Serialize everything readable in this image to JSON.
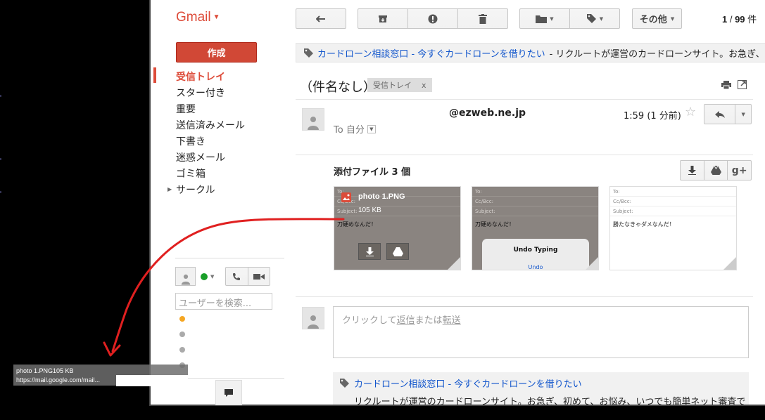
{
  "gmail": {
    "logo": "Gmail",
    "compose": "作成",
    "nav": [
      {
        "label": "受信トレイ",
        "active": true
      },
      {
        "label": "スター付き"
      },
      {
        "label": "重要"
      },
      {
        "label": "送信済みメール"
      },
      {
        "label": "下書き"
      },
      {
        "label": "迷惑メール"
      },
      {
        "label": "ゴミ箱"
      },
      {
        "label": "サークル"
      }
    ],
    "toolbar": {
      "more": "その他",
      "pager_range": "1",
      "pager_sep": " / ",
      "pager_total": "99",
      "pager_unit": " 件"
    }
  },
  "ad_top": {
    "link": "カードローン相談窓口 - 今すぐカードローンを借りたい",
    "text": "- リクルートが運営のカードローンサイト。お急ぎ、初めて"
  },
  "message": {
    "subject": "（件名なし）",
    "label": "受信トレイ",
    "label_close": "x",
    "sender": "@ezweb.ne.jp",
    "to": "To 自分",
    "time": "1:59 (1 分前)"
  },
  "attachments": {
    "title": "添付ファイル 3 個",
    "items": [
      {
        "name": "photo 1.PNG",
        "size": "105 KB",
        "body": "刀硬めなんだ！"
      },
      {
        "name": "",
        "body": "刀硬めなんだ！",
        "popup": "Undo Typing",
        "popup2": "Undo"
      },
      {
        "name": "",
        "body": "勝たなきゃダメなんだ！"
      }
    ],
    "fields": [
      "To:",
      "Cc/Bcc:",
      "Subject:"
    ]
  },
  "reply": {
    "prefix": "クリックして",
    "reply_link": "返信",
    "middle": "または",
    "forward_link": "転送"
  },
  "ad_bottom": {
    "link": "カードローン相談窓口 - 今すぐカードローンを借りたい",
    "text": "リクルートが運営のカードローンサイト。お急ぎ、初めて、お悩み、いつでも簡単ネット審査で大丈夫！"
  },
  "chat": {
    "search_placeholder": "ユーザーを検索..."
  },
  "tooltip": {
    "line1": "photo 1.PNG105 KB",
    "line2": "https://mail.google.com/mail..."
  },
  "colors": {
    "accent": "#dd4b39",
    "link": "#1155cc",
    "arrow": "#e02020"
  }
}
